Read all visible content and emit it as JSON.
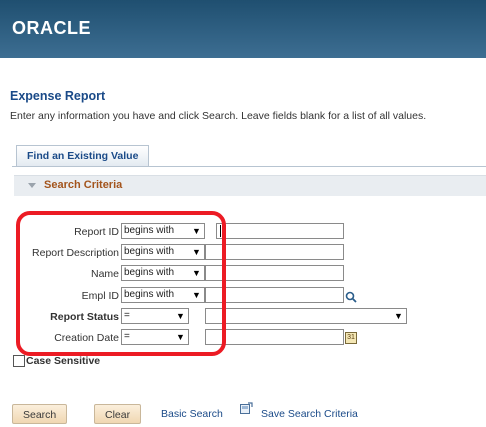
{
  "header": {
    "logo": "ORACLE"
  },
  "page": {
    "title": "Expense Report",
    "instructions": "Enter any information you have and click Search. Leave fields blank for a list of all values."
  },
  "tabs": [
    {
      "label": "Find an Existing Value"
    }
  ],
  "section": {
    "title": "Search Criteria"
  },
  "fields": [
    {
      "label": "Report ID",
      "operator": "begins with",
      "value": ""
    },
    {
      "label": "Report Description",
      "operator": "begins with",
      "value": ""
    },
    {
      "label": "Name",
      "operator": "begins with",
      "value": ""
    },
    {
      "label": "Empl ID",
      "operator": "begins with",
      "value": ""
    },
    {
      "label": "Report Status",
      "operator": "=",
      "value": ""
    },
    {
      "label": "Creation Date",
      "operator": "=",
      "value": ""
    }
  ],
  "case_sensitive": {
    "label": "Case Sensitive",
    "checked": false
  },
  "buttons": {
    "search": "Search",
    "clear": "Clear"
  },
  "links": {
    "basic_search": "Basic Search",
    "save_search": "Save Search Criteria"
  },
  "colors": {
    "header_bg": "#2f5f82",
    "link": "#1a4a88",
    "section_title": "#a3541c",
    "highlight": "#ec1b24"
  },
  "icons": [
    "chevron-down-icon",
    "lookup-magnifier-icon",
    "calendar-icon",
    "save-search-icon",
    "collapse-triangle-icon"
  ]
}
